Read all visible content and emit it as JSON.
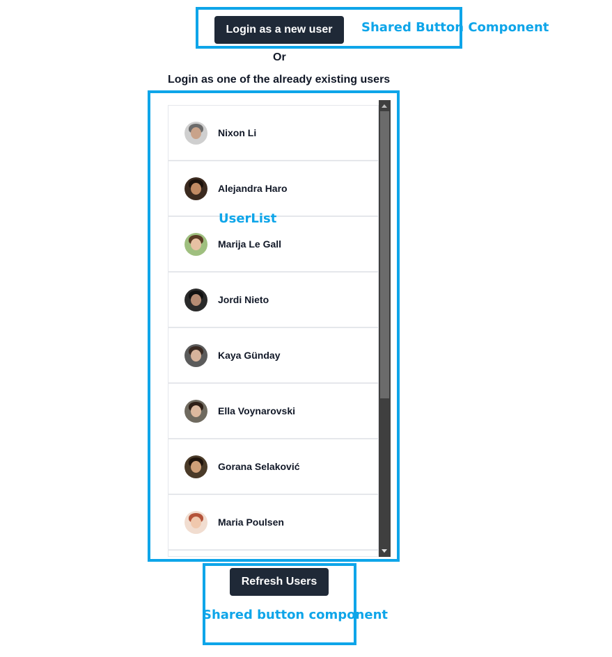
{
  "top": {
    "login_new_user_label": "Login as a new user",
    "or_text": "Or",
    "existing_users_text": "Login as one of the already existing users"
  },
  "annotations": {
    "shared_button_top": "Shared Button Component",
    "userlist": "UserList",
    "shared_button_bottom": "Shared button component"
  },
  "users": [
    {
      "name": "Nixon Li"
    },
    {
      "name": "Alejandra Haro"
    },
    {
      "name": "Marija Le Gall"
    },
    {
      "name": "Jordi Nieto"
    },
    {
      "name": "Kaya Günday"
    },
    {
      "name": "Ella Voynarovski"
    },
    {
      "name": "Gorana Selaković"
    },
    {
      "name": "Maria Poulsen"
    }
  ],
  "refresh_label": "Refresh Users",
  "colors": {
    "annotation": "#0ea5e9",
    "button_bg": "#1f2937",
    "scrollbar_track": "#3f3f3f",
    "scrollbar_thumb": "#6b6b6b"
  }
}
